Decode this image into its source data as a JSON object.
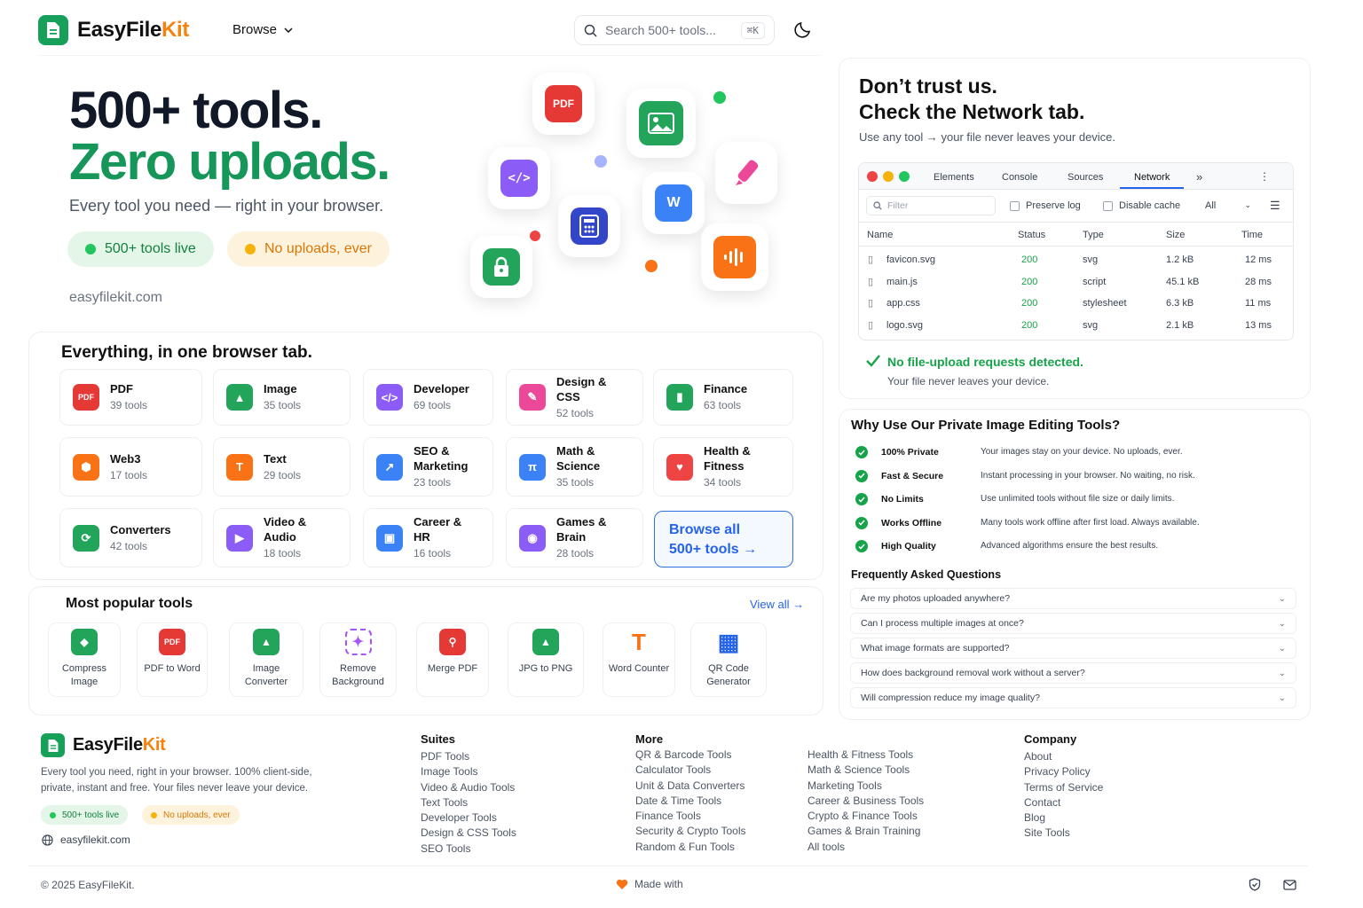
{
  "header": {
    "logo_a": "EasyFile",
    "logo_b": "Kit",
    "browse_label": "Browse",
    "search_placeholder": "Search 500+ tools...",
    "search_shortcut": "⌘K"
  },
  "hero": {
    "line1": "500+ tools.",
    "line2": "Zero uploads.",
    "subtitle": "Every tool you need — right in your browser.",
    "pill_green": "500+ tools live",
    "pill_yellow": "No uploads, ever",
    "domain": "easyfilekit.com",
    "pdf_label": "PDF"
  },
  "categories": {
    "title": "Everything, in one browser tab.",
    "items": [
      {
        "name": "PDF",
        "count": "39 tools",
        "color": "#e53935",
        "icon": "pdf-icon"
      },
      {
        "name": "Image",
        "count": "35 tools",
        "color": "#22a55a",
        "icon": "image-icon"
      },
      {
        "name": "Developer",
        "count": "69 tools",
        "color": "#8b5cf6",
        "icon": "code-icon"
      },
      {
        "name": "Design & CSS",
        "count": "52 tools",
        "color": "#ec4899",
        "icon": "brush-icon"
      },
      {
        "name": "Finance",
        "count": "63 tools",
        "color": "#22a55a",
        "icon": "bar-chart-icon"
      },
      {
        "name": "Web3",
        "count": "17 tools",
        "color": "#f97316",
        "icon": "cube-icon"
      },
      {
        "name": "Text",
        "count": "29 tools",
        "color": "#f97316",
        "icon": "text-icon"
      },
      {
        "name": "SEO & Marketing",
        "count": "23 tools",
        "color": "#3b82f6",
        "icon": "growth-chart-icon"
      },
      {
        "name": "Math & Science",
        "count": "35 tools",
        "color": "#3b82f6",
        "icon": "pi-icon"
      },
      {
        "name": "Health & Fitness",
        "count": "34 tools",
        "color": "#ef4444",
        "icon": "heart-icon"
      },
      {
        "name": "Converters",
        "count": "42 tools",
        "color": "#22a55a",
        "icon": "refresh-icon"
      },
      {
        "name": "Video & Audio",
        "count": "18 tools",
        "color": "#8b5cf6",
        "icon": "play-icon"
      },
      {
        "name": "Career & HR",
        "count": "16 tools",
        "color": "#3b82f6",
        "icon": "briefcase-icon"
      },
      {
        "name": "Games & Brain",
        "count": "28 tools",
        "color": "#8b5cf6",
        "icon": "gamepad-icon"
      }
    ],
    "browse_line1": "Browse all",
    "browse_line2": "500+ tools →"
  },
  "popular": {
    "title": "Most popular tools",
    "view_all": "View all →",
    "items": [
      {
        "label": "Compress Image",
        "icon": "compress-icon"
      },
      {
        "label": "PDF to Word",
        "icon": "pdf-icon"
      },
      {
        "label": "Image Converter",
        "icon": "image-icon"
      },
      {
        "label": "Remove Background",
        "icon": "remove-bg-icon"
      },
      {
        "label": "Merge PDF",
        "icon": "merge-pdf-icon"
      },
      {
        "label": "JPG to PNG",
        "icon": "jpg-png-icon"
      },
      {
        "label": "Word Counter",
        "icon": "text-icon"
      },
      {
        "label": "QR Code Generator",
        "icon": "qr-code-icon"
      }
    ]
  },
  "trust": {
    "title1": "Don’t trust us.",
    "title2": "Check the Network tab.",
    "subtitle": "Use any tool → your file never leaves your device.",
    "devtools": {
      "tabs": [
        "Elements",
        "Console",
        "Sources",
        "Network"
      ],
      "more": "»",
      "filter_placeholder": "Filter",
      "preserve_log": "Preserve log",
      "disable_cache": "Disable cache",
      "throttle": "All",
      "columns": [
        "Name",
        "Status",
        "Type",
        "Size",
        "Time"
      ],
      "rows": [
        {
          "name": "favicon.svg",
          "status": "200",
          "type": "svg",
          "size": "1.2 kB",
          "time": "12 ms"
        },
        {
          "name": "main.js",
          "status": "200",
          "type": "script",
          "size": "45.1 kB",
          "time": "28 ms"
        },
        {
          "name": "app.css",
          "status": "200",
          "type": "stylesheet",
          "size": "6.3 kB",
          "time": "11 ms"
        },
        {
          "name": "logo.svg",
          "status": "200",
          "type": "svg",
          "size": "2.1 kB",
          "time": "13 ms"
        }
      ]
    },
    "result": "No file-upload requests detected.",
    "result_sub": "Your file never leaves your device."
  },
  "why": {
    "title": "Why Use Our Private Image Editing Tools?",
    "items": [
      {
        "label": "100% Private",
        "desc": "Your images stay on your device. No uploads, ever."
      },
      {
        "label": "Fast & Secure",
        "desc": "Instant processing in your browser. No waiting, no risk."
      },
      {
        "label": "No Limits",
        "desc": "Use unlimited tools without file size or daily limits."
      },
      {
        "label": "Works Offline",
        "desc": "Many tools work offline after first load. Always available."
      },
      {
        "label": "High Quality",
        "desc": "Advanced algorithms ensure the best results."
      }
    ],
    "faq_title": "Frequently Asked Questions",
    "faqs": [
      "Are my photos uploaded anywhere?",
      "Can I process multiple images at once?",
      "What image formats are supported?",
      "How does background removal work without a server?",
      "Will compression reduce my image quality?"
    ]
  },
  "footer": {
    "logo_a": "EasyFile",
    "logo_b": "Kit",
    "desc1": "Every tool you need, right in your browser. 100% client-side,",
    "desc2": "private, instant and free. Your files never leave your device.",
    "pill_green": "500+ tools live",
    "pill_yellow": "No uploads, ever",
    "domain": "easyfilekit.com",
    "suites_title": "Suites",
    "suites": [
      "PDF Tools",
      "Image Tools",
      "Video & Audio Tools",
      "Text Tools",
      "Developer Tools",
      "Design & CSS Tools",
      "SEO Tools"
    ],
    "more_title": "More",
    "more1": [
      "QR & Barcode Tools",
      "Calculator Tools",
      "Unit & Data Converters",
      "Date & Time Tools",
      "Finance Tools",
      "Security & Crypto Tools",
      "Random & Fun Tools"
    ],
    "more2": [
      "Health & Fitness Tools",
      "Math & Science Tools",
      "Marketing Tools",
      "Career & Business Tools",
      "Crypto & Finance Tools",
      "Games & Brain Training",
      "All tools"
    ],
    "company_title": "Company",
    "company": [
      "About",
      "Privacy Policy",
      "Terms of Service",
      "Contact",
      "Blog",
      "Site Tools"
    ],
    "copyright": "© 2025 EasyFileKit.",
    "made_with": "Made with"
  }
}
